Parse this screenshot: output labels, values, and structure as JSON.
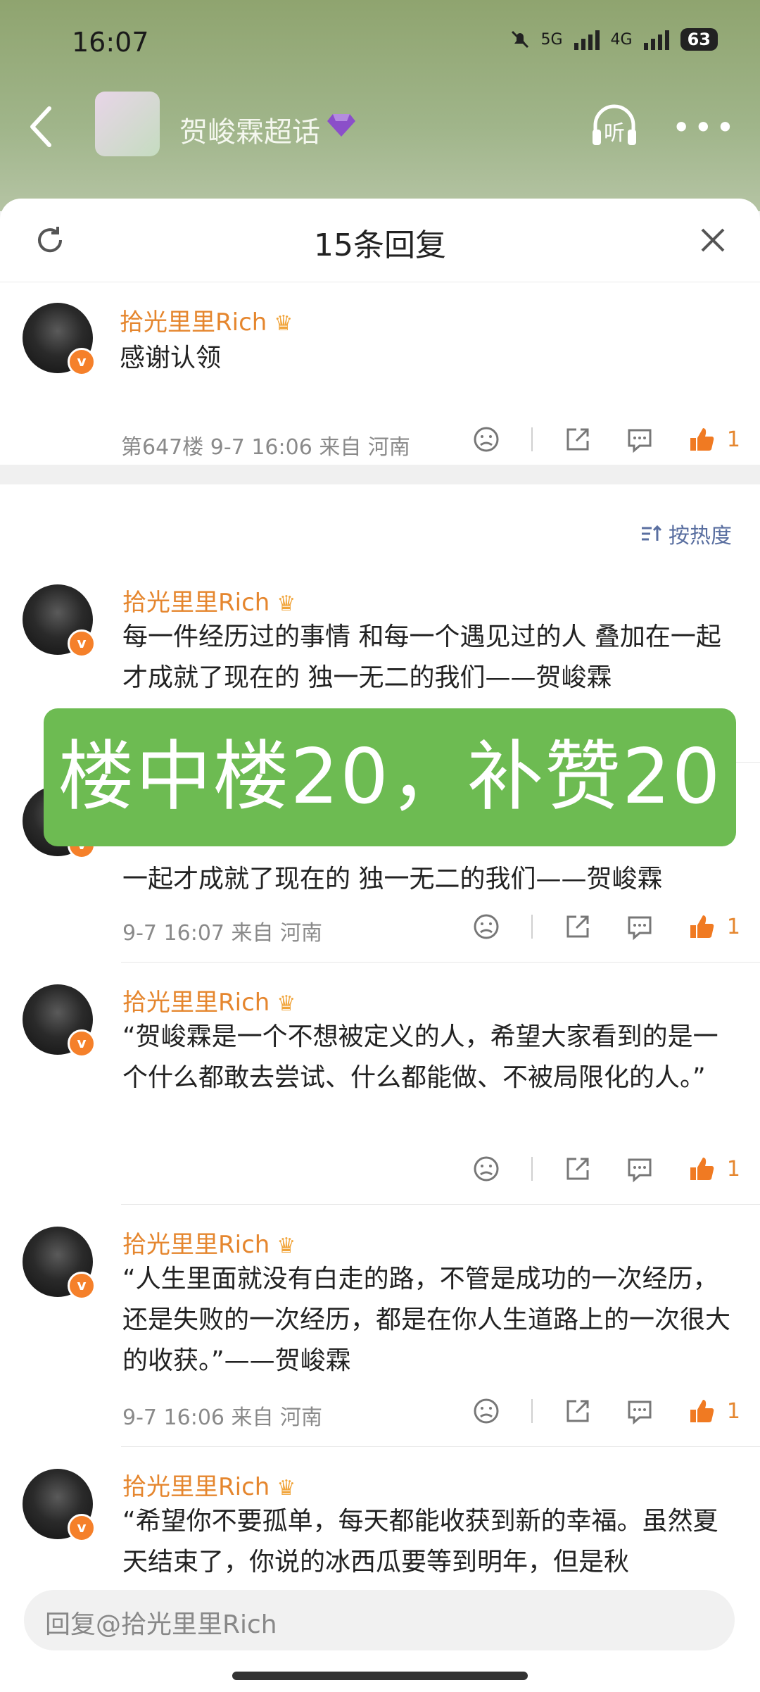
{
  "status_bar": {
    "time": "16:07",
    "sig1": "5G",
    "sig2": "4G",
    "battery": "63"
  },
  "header": {
    "title": "贺峻霖超话",
    "listen_label": "听"
  },
  "sheet": {
    "title": "15条回复"
  },
  "main_comment": {
    "username": "拾光里里Rich",
    "text": "感谢认领",
    "meta": "第647楼 9-7 16:06 来自 河南",
    "likes": "1"
  },
  "sort_label": "按热度",
  "replies": [
    {
      "username": "拾光里里Rich",
      "text": "每一件经历过的事情 和每一个遇见过的人 叠加在一起才成就了现在的 独一无二的我们——贺峻霖"
    },
    {
      "username": "",
      "text": "一起才成就了现在的 独一无二的我们——贺峻霖",
      "meta": "9-7 16:07 来自 河南",
      "likes": "1"
    },
    {
      "username": "拾光里里Rich",
      "text": "“贺峻霖是一个不想被定义的人，希望大家看到的是一个什么都敢去尝试、什么都能做、不被局限化的人。”",
      "meta": "",
      "likes": "1"
    },
    {
      "username": "拾光里里Rich",
      "text": "“人生里面就没有白走的路，不管是成功的一次经历，还是失败的一次经历，都是在你人生道路上的一次很大的收获。”——贺峻霖",
      "meta": "9-7 16:06 来自 河南",
      "likes": "1"
    },
    {
      "username": "拾光里里Rich",
      "text": "“希望你不要孤单，每天都能收获到新的幸福。虽然夏天结束了，你说的冰西瓜要等到明年，但是秋"
    }
  ],
  "banner_text": "楼中楼20，补赞20",
  "reply_placeholder": "回复@拾光里里Rich",
  "colors": {
    "accent": "#e5862e",
    "banner": "#6dbb52"
  }
}
